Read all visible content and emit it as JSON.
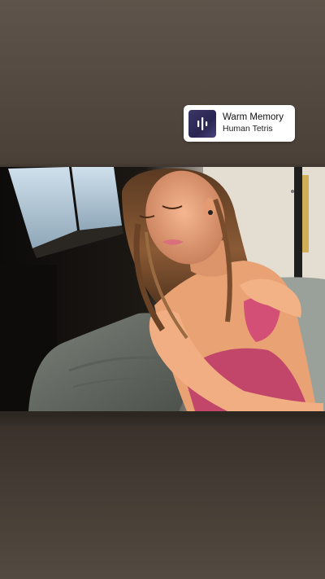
{
  "music_sticker": {
    "title": "Warm Memory",
    "artist": "Human Tetris",
    "icon": "soundwave-icon"
  }
}
